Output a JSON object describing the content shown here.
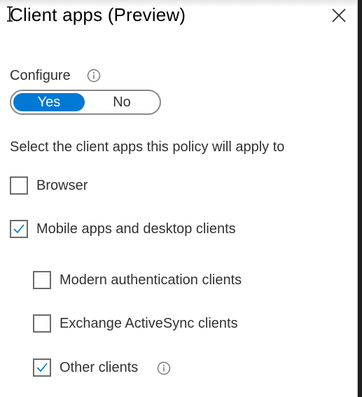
{
  "panel": {
    "title": "Client apps (Preview)",
    "close_icon": "close-icon"
  },
  "configure": {
    "label": "Configure",
    "info_icon": "info-icon",
    "options": [
      "Yes",
      "No"
    ],
    "selected": "Yes"
  },
  "description": "Select the client apps this policy will apply to",
  "checkboxes": {
    "browser": {
      "label": "Browser",
      "checked": false
    },
    "mobile_desktop": {
      "label": "Mobile apps and desktop clients",
      "checked": true
    },
    "modern_auth": {
      "label": "Modern authentication clients",
      "checked": false
    },
    "exchange_activesync": {
      "label": "Exchange ActiveSync clients",
      "checked": false
    },
    "other_clients": {
      "label": "Other clients",
      "checked": true,
      "info_icon": "info-icon"
    }
  },
  "colors": {
    "accent": "#0078d4",
    "text": "#323130",
    "border": "#8a8886"
  }
}
